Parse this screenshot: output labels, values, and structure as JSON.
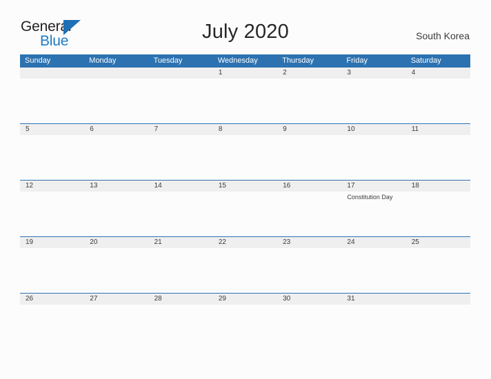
{
  "brand": {
    "name_part1": "General",
    "name_part2": "Blue",
    "flag_icon": "blue-triangle-flag-icon",
    "primary_color": "#2C72B0",
    "accent_color": "#1F7BC4"
  },
  "header": {
    "title": "July 2020",
    "region": "South Korea"
  },
  "calendar": {
    "weekdays": [
      "Sunday",
      "Monday",
      "Tuesday",
      "Wednesday",
      "Thursday",
      "Friday",
      "Saturday"
    ],
    "weeks": [
      {
        "dates": [
          "",
          "",
          "",
          "1",
          "2",
          "3",
          "4"
        ],
        "events": [
          "",
          "",
          "",
          "",
          "",
          "",
          ""
        ]
      },
      {
        "dates": [
          "5",
          "6",
          "7",
          "8",
          "9",
          "10",
          "11"
        ],
        "events": [
          "",
          "",
          "",
          "",
          "",
          "",
          ""
        ]
      },
      {
        "dates": [
          "12",
          "13",
          "14",
          "15",
          "16",
          "17",
          "18"
        ],
        "events": [
          "",
          "",
          "",
          "",
          "",
          "Constitution Day",
          ""
        ]
      },
      {
        "dates": [
          "19",
          "20",
          "21",
          "22",
          "23",
          "24",
          "25"
        ],
        "events": [
          "",
          "",
          "",
          "",
          "",
          "",
          ""
        ]
      },
      {
        "dates": [
          "26",
          "27",
          "28",
          "29",
          "30",
          "31",
          ""
        ],
        "events": [
          "",
          "",
          "",
          "",
          "",
          "",
          ""
        ]
      }
    ]
  }
}
